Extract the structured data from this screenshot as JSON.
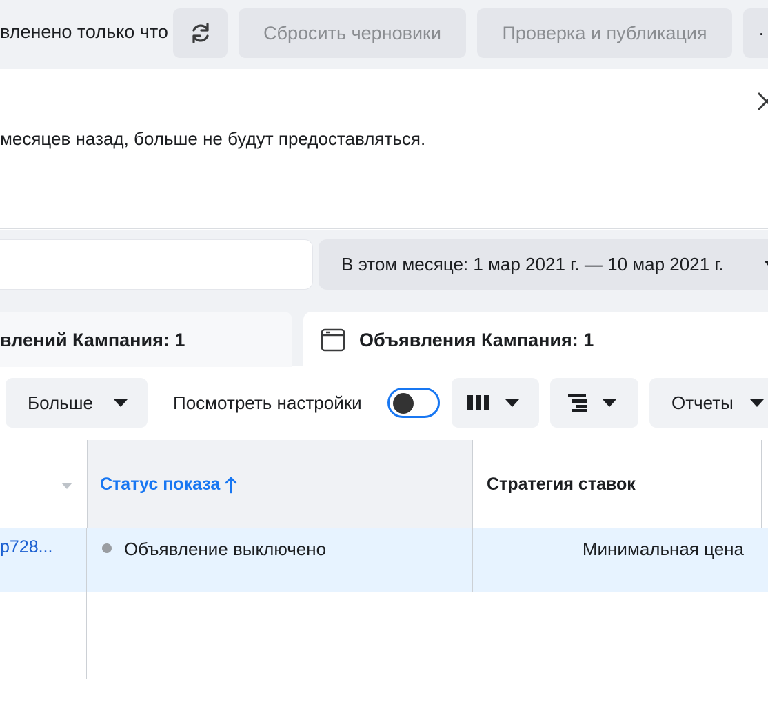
{
  "topbar": {
    "updated_text": "вленено только что",
    "reset_drafts_label": "Сбросить черновики",
    "review_publish_label": "Проверка и публикация",
    "more_label": "·"
  },
  "notice": {
    "text": "месяцев назад, больше не будут предоставляться."
  },
  "filters": {
    "date_range_label": "В этом месяце: 1 мар 2021 г. — 10 мар 2021 г."
  },
  "tabs": {
    "adsets_label": "влений Кампания: 1",
    "ads_label": "Объявления Кампания: 1"
  },
  "toolbar": {
    "more_label": "Больше",
    "view_settings_label": "Посмотреть настройки",
    "reports_label": "Отчеты"
  },
  "table": {
    "headers": {
      "status": "Статус показа",
      "strategy": "Стратегия ставок"
    },
    "rows": [
      {
        "name": "p728...",
        "status": "Объявление выключено",
        "strategy": "Минимальная цена"
      }
    ]
  },
  "colors": {
    "accent": "#1877f2",
    "selected_row": "#e7f3ff",
    "toolbar_bg": "#f0f2f5"
  }
}
